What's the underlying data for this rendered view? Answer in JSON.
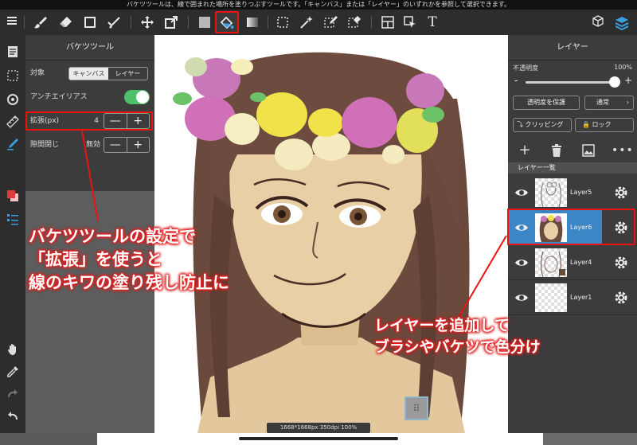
{
  "status_text": "バケツツールは、線で囲まれた場所を塗りつぶすツールです。「キャンバス」または「レイヤー」のいずれかを参照して選択できます。",
  "toolbar": {
    "icons": [
      "menu-icon",
      "brush-icon",
      "eraser-icon",
      "square-icon",
      "check-brush-icon",
      "move-icon",
      "transform-icon",
      "fill-color-icon",
      "bucket-icon",
      "gradient-icon",
      "lasso-select-icon",
      "magic-wand-icon",
      "select-pen-icon",
      "select-eraser-icon",
      "frame-icon",
      "cursor-select-icon",
      "text-icon",
      "3d-material-icon",
      "layers-icon"
    ],
    "selected": "bucket-icon",
    "text_tool_label": "T",
    "accent": "#e11111"
  },
  "bucket_panel": {
    "title": "バケツツール",
    "target_label": "対象",
    "target_options": [
      "キャンバス",
      "レイヤー"
    ],
    "target_selected": "キャンバス",
    "antialias_label": "アンチエイリアス",
    "antialias_on": true,
    "expand_label": "拡張(px)",
    "expand_value": "4",
    "gap_label": "隙間閉じ",
    "gap_value": "無効",
    "minus": "—",
    "plus": "+"
  },
  "canvas_info": "1668*1668px 350dpi 100%",
  "layer_panel": {
    "title": "レイヤー",
    "opacity_label": "不透明度",
    "opacity_value": "100%",
    "opacity_fraction": 1.0,
    "minus": "-",
    "plus": "+",
    "protect_label": "透明度を保護",
    "blend_label": "通常",
    "clipping_label": "クリッピング",
    "lock_label": "ロック",
    "list_title": "レイヤー一覧",
    "layers": [
      {
        "name": "Layer5",
        "active": false
      },
      {
        "name": "Layer6",
        "active": true
      },
      {
        "name": "Layer4",
        "active": false
      },
      {
        "name": "Layer1",
        "active": false
      }
    ]
  },
  "annotations": {
    "left_1": "バケツツールの設定で",
    "left_2": "「拡張」を使うと",
    "left_3": "線のキワの塗り残し防止に",
    "right_1": "レイヤーを追加して",
    "right_2": "ブラシやバケツで色分け"
  }
}
